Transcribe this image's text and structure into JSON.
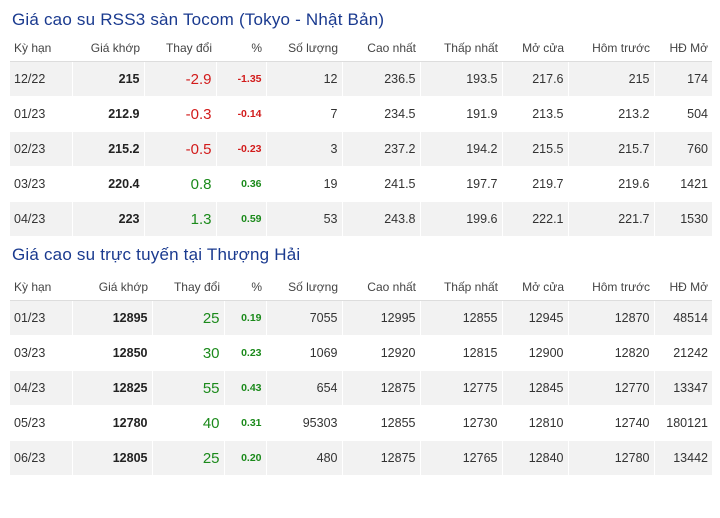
{
  "colors": {
    "title": "#1a3a8f",
    "down": "#d21b1b",
    "up": "#1b8a1b",
    "stripe": "#f2f2f2"
  },
  "tocom": {
    "title": "Giá cao su RSS3 sàn Tocom (Tokyo - Nhật Bản)",
    "headers": [
      "Kỳ hạn",
      "Giá khớp",
      "Thay đổi",
      "%",
      "Số lượng",
      "Cao nhất",
      "Thấp nhất",
      "Mở cửa",
      "Hôm trước",
      "HĐ Mở"
    ],
    "rows": [
      {
        "term": "12/22",
        "price": "215",
        "change": "-2.9",
        "pct": "-1.35",
        "volume": "12",
        "high": "236.5",
        "low": "193.5",
        "open": "217.6",
        "prev": "215",
        "oi": "174",
        "dir": "down"
      },
      {
        "term": "01/23",
        "price": "212.9",
        "change": "-0.3",
        "pct": "-0.14",
        "volume": "7",
        "high": "234.5",
        "low": "191.9",
        "open": "213.5",
        "prev": "213.2",
        "oi": "504",
        "dir": "down"
      },
      {
        "term": "02/23",
        "price": "215.2",
        "change": "-0.5",
        "pct": "-0.23",
        "volume": "3",
        "high": "237.2",
        "low": "194.2",
        "open": "215.5",
        "prev": "215.7",
        "oi": "760",
        "dir": "down"
      },
      {
        "term": "03/23",
        "price": "220.4",
        "change": "0.8",
        "pct": "0.36",
        "volume": "19",
        "high": "241.5",
        "low": "197.7",
        "open": "219.7",
        "prev": "219.6",
        "oi": "1421",
        "dir": "up"
      },
      {
        "term": "04/23",
        "price": "223",
        "change": "1.3",
        "pct": "0.59",
        "volume": "53",
        "high": "243.8",
        "low": "199.6",
        "open": "222.1",
        "prev": "221.7",
        "oi": "1530",
        "dir": "up"
      }
    ]
  },
  "shanghai": {
    "title": "Giá cao su trực tuyến tại Thượng Hải",
    "headers": [
      "Kỳ hạn",
      "Giá khớp",
      "Thay đổi",
      "%",
      "Số lượng",
      "Cao nhất",
      "Thấp nhất",
      "Mở cửa",
      "Hôm trước",
      "HĐ Mở"
    ],
    "rows": [
      {
        "term": "01/23",
        "price": "12895",
        "change": "25",
        "pct": "0.19",
        "volume": "7055",
        "high": "12995",
        "low": "12855",
        "open": "12945",
        "prev": "12870",
        "oi": "48514",
        "dir": "up"
      },
      {
        "term": "03/23",
        "price": "12850",
        "change": "30",
        "pct": "0.23",
        "volume": "1069",
        "high": "12920",
        "low": "12815",
        "open": "12900",
        "prev": "12820",
        "oi": "21242",
        "dir": "up"
      },
      {
        "term": "04/23",
        "price": "12825",
        "change": "55",
        "pct": "0.43",
        "volume": "654",
        "high": "12875",
        "low": "12775",
        "open": "12845",
        "prev": "12770",
        "oi": "13347",
        "dir": "up"
      },
      {
        "term": "05/23",
        "price": "12780",
        "change": "40",
        "pct": "0.31",
        "volume": "95303",
        "high": "12855",
        "low": "12730",
        "open": "12810",
        "prev": "12740",
        "oi": "180121",
        "dir": "up"
      },
      {
        "term": "06/23",
        "price": "12805",
        "change": "25",
        "pct": "0.20",
        "volume": "480",
        "high": "12875",
        "low": "12765",
        "open": "12840",
        "prev": "12780",
        "oi": "13442",
        "dir": "up"
      }
    ]
  }
}
